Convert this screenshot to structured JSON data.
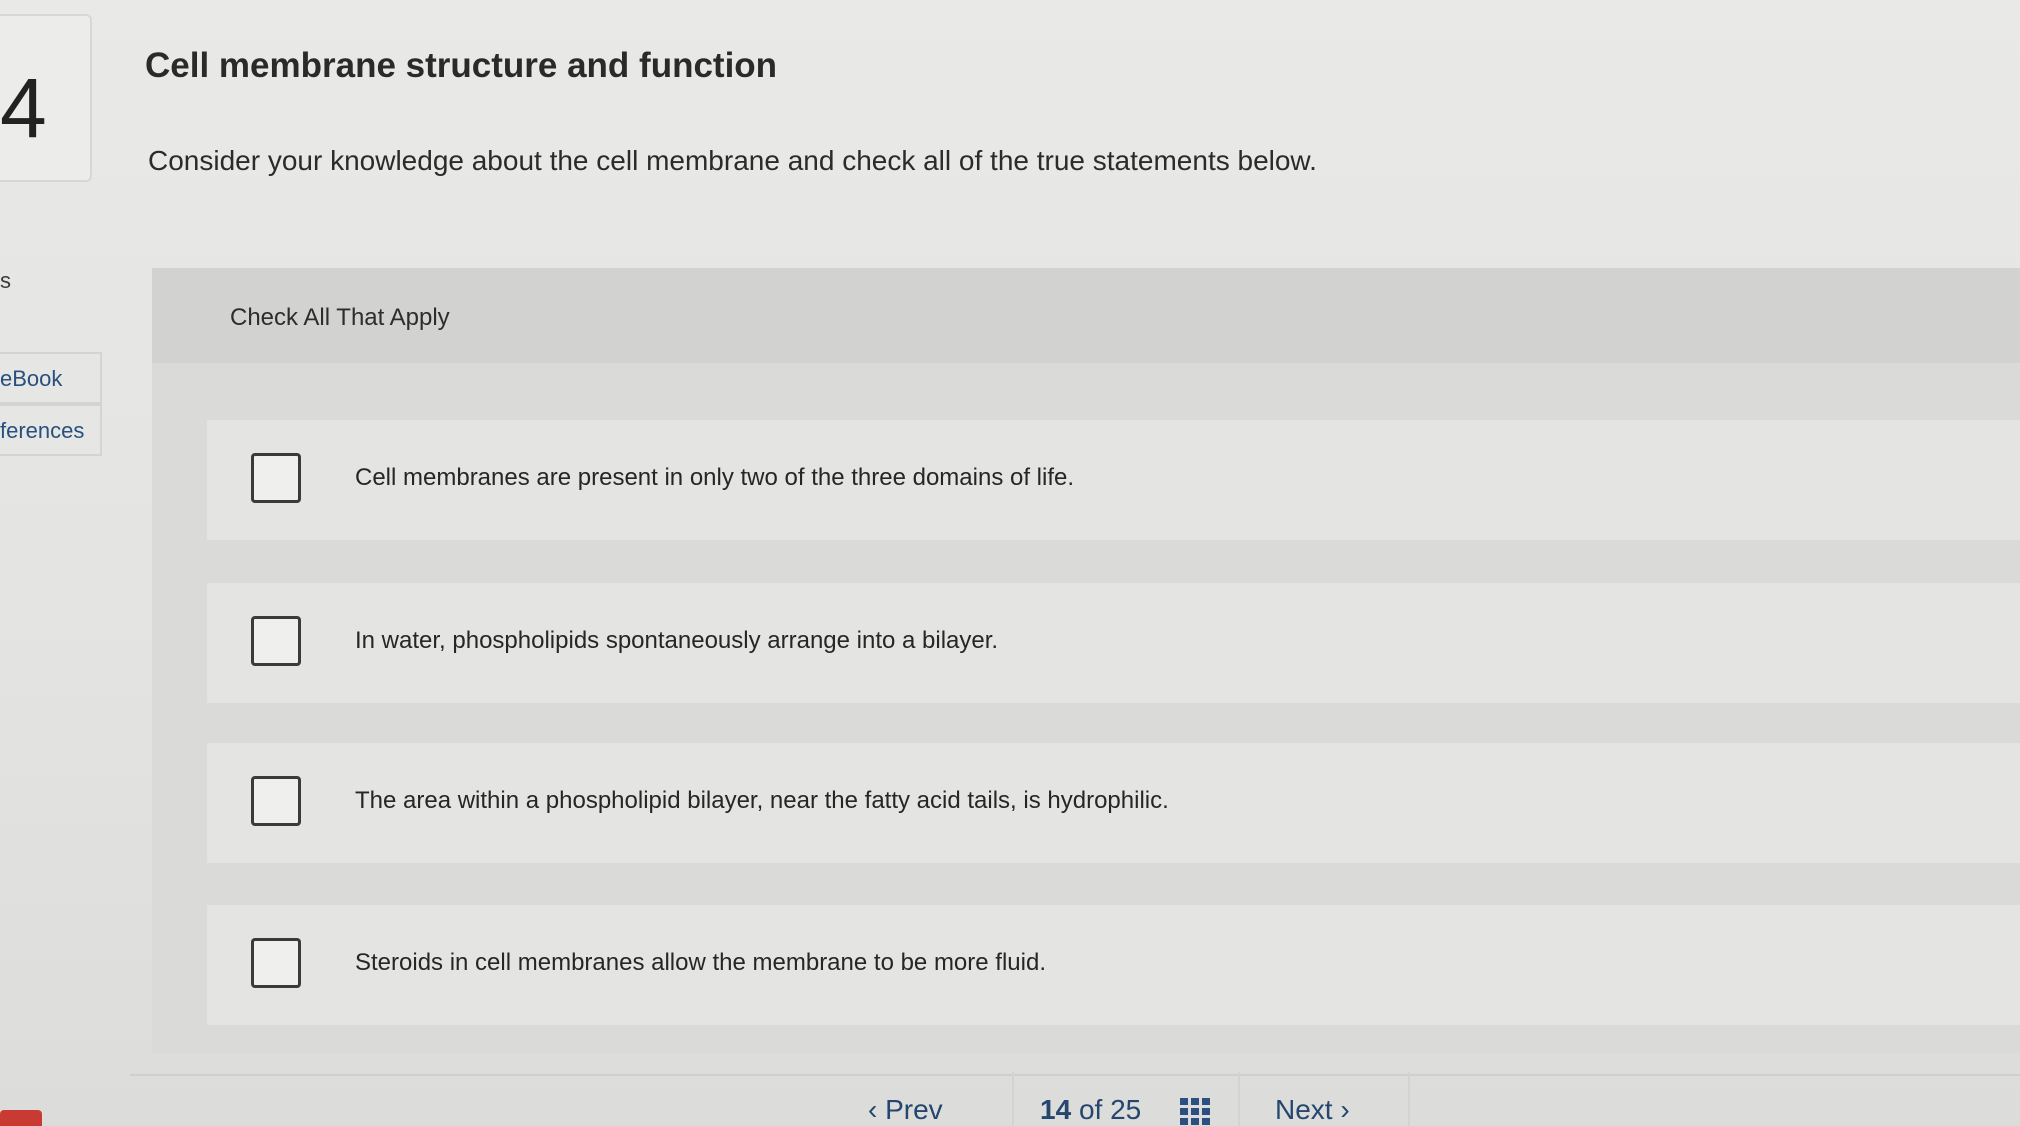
{
  "question": {
    "number": "4",
    "title": "Cell membrane structure and function",
    "instructions": "Consider your knowledge about the cell membrane and check all of the true statements below."
  },
  "sidebar": {
    "partial_label": "s",
    "ebook_label": "eBook",
    "references_label": "ferences"
  },
  "answer": {
    "header": "Check All That Apply",
    "options": [
      {
        "text": "Cell membranes are present in only two of the three domains of life.",
        "checked": false
      },
      {
        "text": "In water, phospholipids spontaneously arrange into a bilayer.",
        "checked": false
      },
      {
        "text": "The area within a phospholipid bilayer, near the fatty acid tails, is hydrophilic.",
        "checked": false
      },
      {
        "text": "Steroids in cell membranes allow the membrane to be more fluid.",
        "checked": false
      }
    ]
  },
  "footer": {
    "prev_label": "Prev",
    "current_page": "14",
    "of_label": "of",
    "total_pages": "25",
    "next_label": "Next",
    "grid_icon": "grid-icon",
    "prev_icon": "chevron-left-icon",
    "next_icon": "chevron-right-icon"
  },
  "colors": {
    "link": "#24466f",
    "panel": "#dadad8",
    "accent_tab": "#c93a33"
  }
}
